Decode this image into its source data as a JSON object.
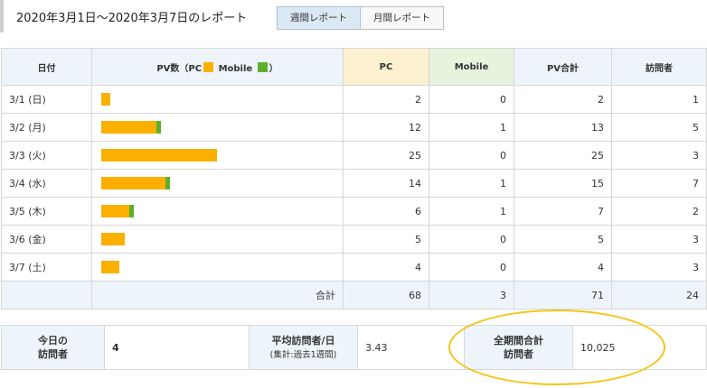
{
  "header": {
    "title": "2020年3月1日～2020年3月7日のレポート",
    "tabs": [
      {
        "label": "週間レポート",
        "active": true
      },
      {
        "label": "月間レポート",
        "active": false
      }
    ]
  },
  "colors": {
    "pc": "#fbb000",
    "mobile": "#5cb02e",
    "header_bg": "#edf5fa",
    "highlight": "#f5c518"
  },
  "table": {
    "headers": {
      "date": "日付",
      "pv_prefix": "PV数（PC",
      "pv_mobile": "Mobile",
      "pv_suffix": "）",
      "pc": "PC",
      "mobile": "Mobile",
      "pv_total": "PV合計",
      "visitors": "訪問者"
    },
    "rows": [
      {
        "date": "3/1 (日)",
        "pc": 2,
        "mobile": 0,
        "pv_total": 2,
        "visitors": 1
      },
      {
        "date": "3/2 (月)",
        "pc": 12,
        "mobile": 1,
        "pv_total": 13,
        "visitors": 5
      },
      {
        "date": "3/3 (火)",
        "pc": 25,
        "mobile": 0,
        "pv_total": 25,
        "visitors": 3
      },
      {
        "date": "3/4 (水)",
        "pc": 14,
        "mobile": 1,
        "pv_total": 15,
        "visitors": 7
      },
      {
        "date": "3/5 (木)",
        "pc": 6,
        "mobile": 1,
        "pv_total": 7,
        "visitors": 2
      },
      {
        "date": "3/6 (金)",
        "pc": 5,
        "mobile": 0,
        "pv_total": 5,
        "visitors": 3
      },
      {
        "date": "3/7 (土)",
        "pc": 4,
        "mobile": 0,
        "pv_total": 4,
        "visitors": 3
      }
    ],
    "total": {
      "label": "合計",
      "pc": 68,
      "mobile": 3,
      "pv_total": 71,
      "visitors": 24
    }
  },
  "summary": {
    "today_label_1": "今日の",
    "today_label_2": "訪問者",
    "today_value": "4",
    "avg_label": "平均訪問者/日",
    "avg_sub": "(集計:過去1週間)",
    "avg_value": "3.43",
    "alltime_label_1": "全期間合計",
    "alltime_label_2": "訪問者",
    "alltime_value": "10,025"
  }
}
